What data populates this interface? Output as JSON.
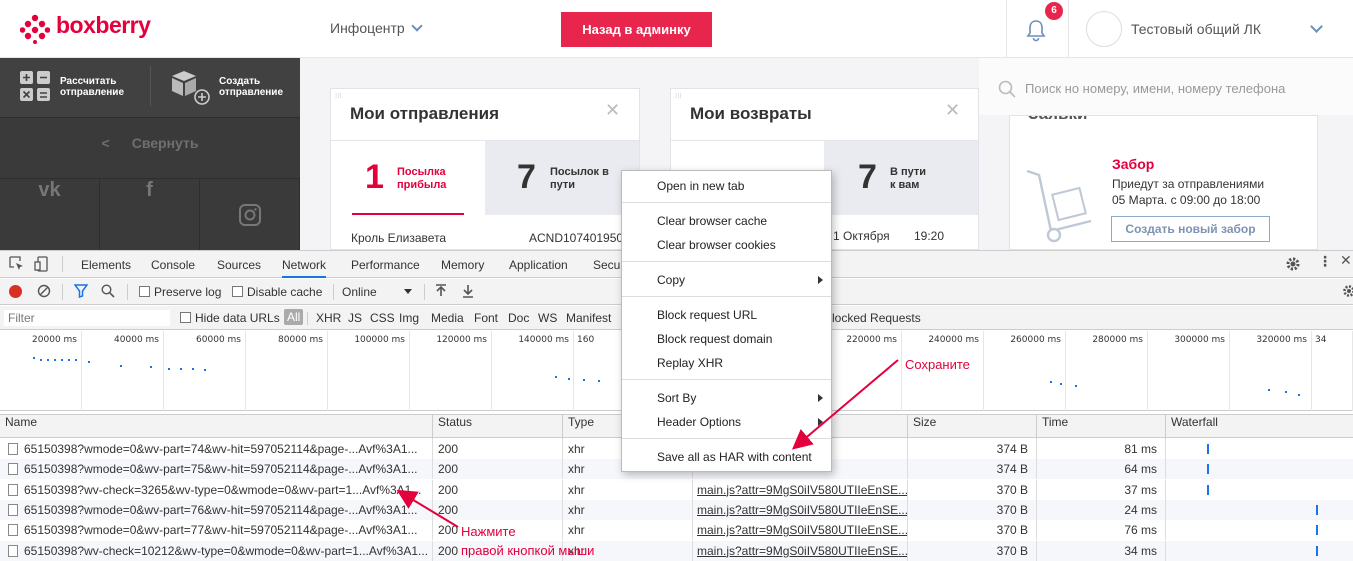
{
  "header": {
    "logo_text": "boxberry",
    "infocenter": "Инфоцентр",
    "admin_button": "Назад в админку",
    "notifications_count": "6",
    "account_name": "Тестовый общий ЛК"
  },
  "sidebar": {
    "calc_label_1": "Рассчитать",
    "calc_label_2": "отправление",
    "create_label_1": "Создать",
    "create_label_2": "отправление",
    "collapse_label": "Свернуть",
    "social": [
      "vk-icon",
      "facebook-icon",
      "instagram-icon"
    ]
  },
  "cards": {
    "shipments": {
      "title": "Мои отправления",
      "arrived_count": "1",
      "arrived_label_1": "Посылка",
      "arrived_label_2": "прибыла",
      "transit_count": "7",
      "transit_label_1": "Посылок в",
      "transit_label_2": "пути",
      "recipient": "Кроль Елизавета",
      "tracking": "ACND107401950"
    },
    "returns": {
      "title": "Мои возвраты",
      "count_right": "7",
      "label_right_1": "В пути",
      "label_right_2": "к вам",
      "date": "1 Октября",
      "time": "19:20"
    },
    "pickup": {
      "title_partial": "Заявки",
      "heading": "Забор",
      "text_1": "Приедут за отправлениями",
      "text_2": "05 Марта. с 09:00 до 18:00",
      "button": "Создать новый забор"
    },
    "search_placeholder": "Поиск но номеру, имени, номеру телефона"
  },
  "devtools": {
    "tabs": [
      "Elements",
      "Console",
      "Sources",
      "Network",
      "Performance",
      "Memory",
      "Application",
      "Secu"
    ],
    "active_tab": "Network",
    "preserve_log": "Preserve log",
    "disable_cache": "Disable cache",
    "throttle": "Online",
    "filter_placeholder": "Filter",
    "hide_data_urls": "Hide data URLs",
    "type_filters": [
      "All",
      "XHR",
      "JS",
      "CSS",
      "Img",
      "Media",
      "Font",
      "Doc",
      "WS",
      "Manifest"
    ],
    "blocked_requests": "locked Requests",
    "timeline_ticks": [
      "20000 ms",
      "40000 ms",
      "60000 ms",
      "80000 ms",
      "100000 ms",
      "120000 ms",
      "140000 ms",
      "160",
      "220000 ms",
      "240000 ms",
      "260000 ms",
      "280000 ms",
      "300000 ms",
      "320000 ms",
      "34"
    ],
    "columns": {
      "name": "Name",
      "status": "Status",
      "type": "Type",
      "size": "Size",
      "time": "Time",
      "waterfall": "Waterfall"
    },
    "rows": [
      {
        "name": "65150398?wmode=0&wv-part=74&wv-hit=597052114&page-...Avf%3A1...",
        "status": "200",
        "type": "xhr",
        "initiator": "",
        "size": "374 B",
        "time": "81 ms",
        "wf": 0.22
      },
      {
        "name": "65150398?wmode=0&wv-part=75&wv-hit=597052114&page-...Avf%3A1...",
        "status": "200",
        "type": "xhr",
        "initiator": "",
        "size": "374 B",
        "time": "64 ms",
        "wf": 0.22
      },
      {
        "name": "65150398?wv-check=3265&wv-type=0&wmode=0&wv-part=1...Avf%3A1...",
        "status": "200",
        "type": "xhr",
        "initiator": "main.js?attr=9MgS0iIV580UTIIeEnSE...",
        "size": "370 B",
        "time": "37 ms",
        "wf": 0.22
      },
      {
        "name": "65150398?wmode=0&wv-part=76&wv-hit=597052114&page-...Avf%3A1...",
        "status": "200",
        "type": "xhr",
        "initiator": "main.js?attr=9MgS0iIV580UTIIeEnSE...",
        "size": "370 B",
        "time": "24 ms",
        "wf": 0.8
      },
      {
        "name": "65150398?wmode=0&wv-part=77&wv-hit=597052114&page-...Avf%3A1...",
        "status": "200",
        "type": "xhr",
        "initiator": "main.js?attr=9MgS0iIV580UTIIeEnSE...",
        "size": "370 B",
        "time": "76 ms",
        "wf": 0.8
      },
      {
        "name": "65150398?wv-check=10212&wv-type=0&wmode=0&wv-part=1...Avf%3A1...",
        "status": "200",
        "type": "xhr",
        "initiator": "main.js?attr=9MgS0iIV580UTIIeEnSE...",
        "size": "370 B",
        "time": "34 ms",
        "wf": 0.8
      }
    ]
  },
  "context_menu": {
    "items": [
      "Open in new tab",
      "Clear browser cache",
      "Clear browser cookies",
      "Copy",
      "Block request URL",
      "Block request domain",
      "Replay XHR",
      "Sort By",
      "Header Options",
      "Save all as HAR with content"
    ]
  },
  "annotations": {
    "save": "Сохраните",
    "click_1": "Нажмите",
    "click_2": "правой кнопкой мыши"
  },
  "colors": {
    "brand": "#e4003c",
    "button": "#e8264d",
    "annotation": "#e4003c"
  }
}
